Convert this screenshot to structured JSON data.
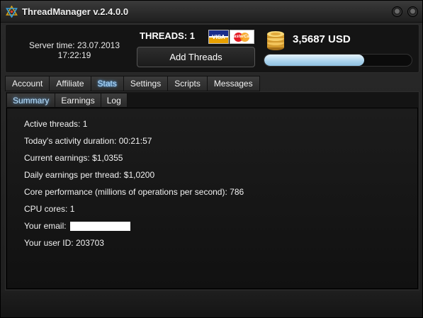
{
  "window": {
    "title": "ThreadManager v.2.4.0.0"
  },
  "header": {
    "server_time_label": "Server time: 23.07.2013",
    "server_time_clock": "17:22:19",
    "threads_label": "THREADS: 1",
    "visa_text": "VISA",
    "mastercard_text": "MasterCard",
    "add_threads_label": "Add Threads",
    "balance": "3,5687 USD",
    "progress_fraction": 0.68
  },
  "tabs": [
    {
      "label": "Account",
      "active": false
    },
    {
      "label": "Affiliate",
      "active": false
    },
    {
      "label": "Stats",
      "active": true
    },
    {
      "label": "Settings",
      "active": false
    },
    {
      "label": "Scripts",
      "active": false
    },
    {
      "label": "Messages",
      "active": false
    }
  ],
  "subtabs": [
    {
      "label": "Summary",
      "active": true
    },
    {
      "label": "Earnings",
      "active": false
    },
    {
      "label": "Log",
      "active": false
    }
  ],
  "stats": [
    {
      "label": "Active threads:",
      "value": "1"
    },
    {
      "label": "Today's activity duration:",
      "value": "00:21:57"
    },
    {
      "label": "Current earnings:",
      "value": "$1,0355"
    },
    {
      "label": "Daily earnings per thread:",
      "value": "$1,0200"
    },
    {
      "label": "Core performance (millions of operations per second):",
      "value": "786"
    },
    {
      "label": "CPU cores:",
      "value": "1"
    },
    {
      "label": "Your email:",
      "value": ""
    },
    {
      "label": "Your user ID:",
      "value": "203703"
    }
  ],
  "colors": {
    "accent_tab_text": "#bde4ff",
    "progress_fill": "#a9d2ec",
    "coin": "#e2a93a"
  }
}
